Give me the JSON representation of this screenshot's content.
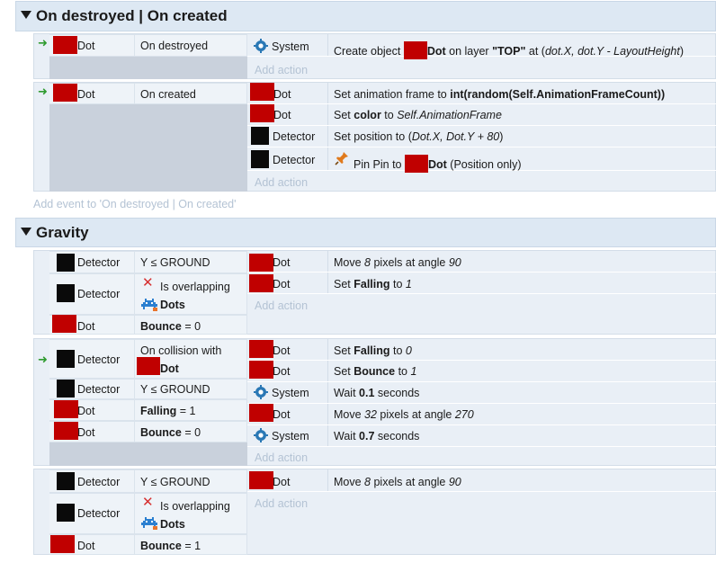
{
  "groups": [
    {
      "title": "On destroyed | On created",
      "add_event": "Add event to 'On destroyed | On created'"
    },
    {
      "title": "Gravity"
    }
  ],
  "labels": {
    "add_action": "Add action",
    "dot": "Dot",
    "detector": "Detector",
    "system": "System",
    "dots": "Dots"
  },
  "events": {
    "e1": {
      "condition": "On destroyed",
      "action": {
        "pre": "Create object ",
        "obj": "Dot",
        "mid1": " on layer ",
        "layer": "\"TOP\"",
        "mid2": " at (",
        "expr": "dot.X, dot.Y - LayoutHeight",
        "end": ")"
      }
    },
    "e2": {
      "condition": "On created",
      "actions": {
        "a1": {
          "pre": "Set animation frame to ",
          "expr": "int(random(Self.AnimationFrameCount))"
        },
        "a2": {
          "pre": "Set ",
          "var": "color",
          "mid": " to ",
          "expr": "Self.AnimationFrame"
        },
        "a3": {
          "pre": "Set position to (",
          "expr": "Dot.X, Dot.Y + 80",
          "end": ")"
        },
        "a4": {
          "pre": "Pin Pin to ",
          "obj": "Dot",
          "end": " (Position only)"
        }
      }
    },
    "e3": {
      "c1": "Y ≤ GROUND",
      "c2": "Is overlapping",
      "c3": {
        "var": "Bounce",
        "rest": " = 0"
      },
      "a1": {
        "pre": "Move ",
        "num": "8",
        "mid": " pixels at angle ",
        "angle": "90"
      },
      "a2": {
        "pre": "Set ",
        "var": "Falling",
        "mid": " to ",
        "val": "1"
      }
    },
    "e4": {
      "c1": "On collision with",
      "c2": "Y ≤ GROUND",
      "c3": {
        "var": "Falling",
        "rest": " = 1"
      },
      "c4": {
        "var": "Bounce",
        "rest": " = 0"
      },
      "a1": {
        "pre": "Set ",
        "var": "Falling",
        "mid": " to ",
        "val": "0"
      },
      "a2": {
        "pre": "Set ",
        "var": "Bounce",
        "mid": " to ",
        "val": "1"
      },
      "a3": {
        "pre": "Wait ",
        "num": "0.1",
        "end": " seconds"
      },
      "a4": {
        "pre": "Move ",
        "num": "32",
        "mid": " pixels at angle ",
        "angle": "270"
      },
      "a5": {
        "pre": "Wait ",
        "num": "0.7",
        "end": " seconds"
      }
    },
    "e5": {
      "c1": "Y ≤ GROUND",
      "c2": "Is overlapping",
      "c3": {
        "var": "Bounce",
        "rest": " = 1"
      },
      "a1": {
        "pre": "Move ",
        "num": "8",
        "mid": " pixels at angle ",
        "angle": "90"
      }
    }
  },
  "colors": {
    "obj_red": "#c00000",
    "obj_black": "#0a0a0a",
    "header_bg": "#dde8f3",
    "add_text": "#b4c3d4"
  }
}
